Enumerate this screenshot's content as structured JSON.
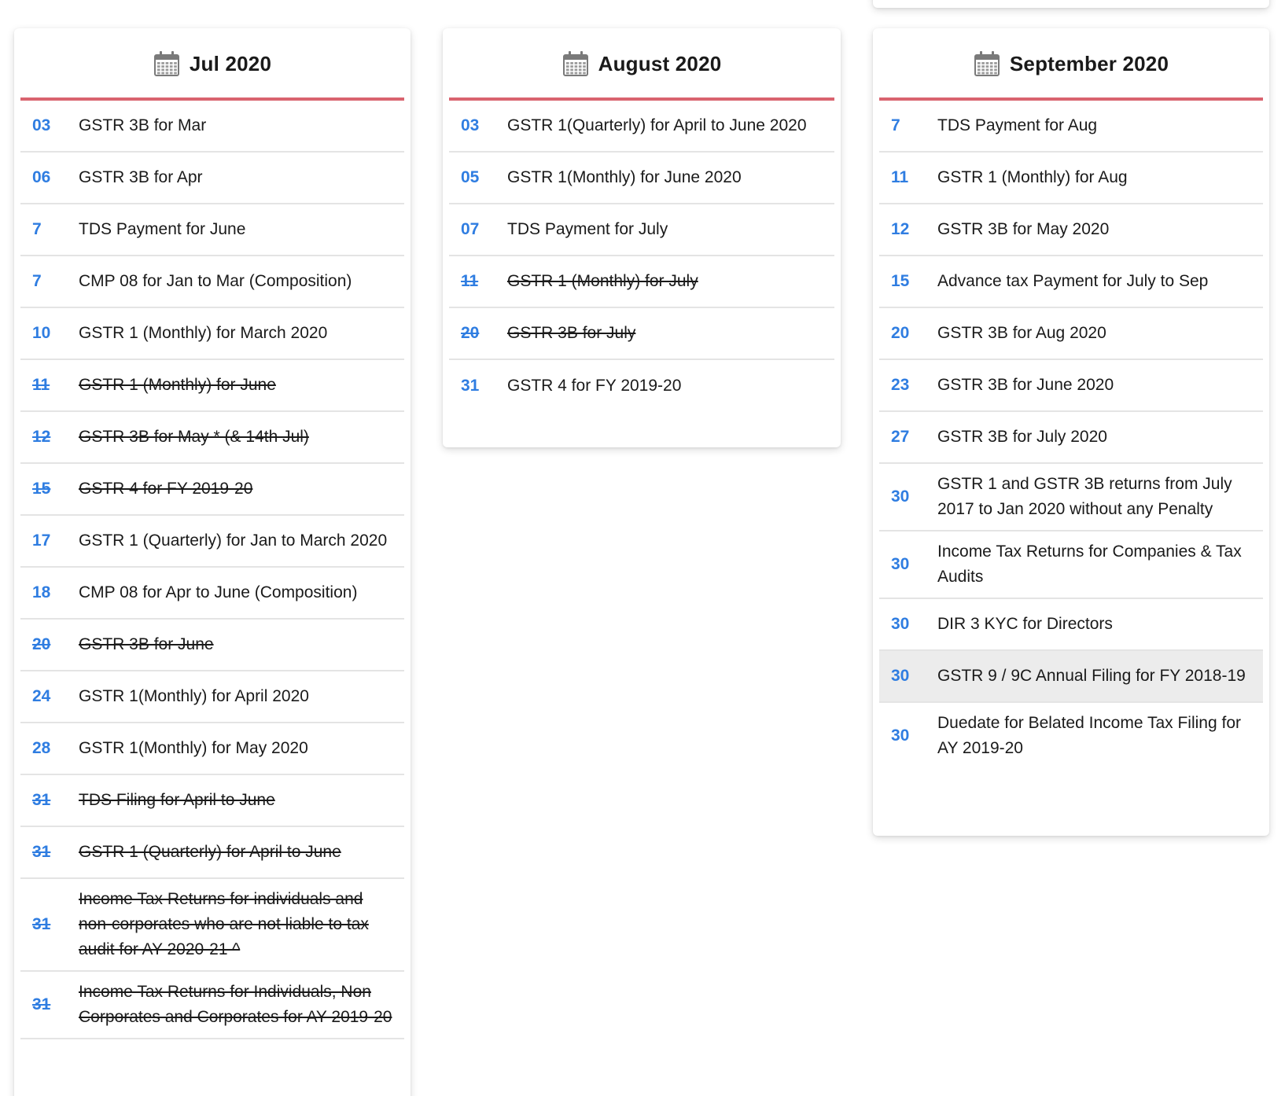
{
  "colors": {
    "accent_rule": "#d9636f",
    "date_blue": "#2f7de1",
    "highlight_row": "#ececec"
  },
  "icon": "calendar-icon",
  "columns": [
    {
      "title": "Jul 2020",
      "items": [
        {
          "day": "03",
          "text": "GSTR 3B for Mar",
          "done": false
        },
        {
          "day": "06",
          "text": "GSTR 3B for Apr",
          "done": false
        },
        {
          "day": "7",
          "text": "TDS Payment for June",
          "done": false
        },
        {
          "day": "7",
          "text": "CMP 08 for Jan to Mar (Composition)",
          "done": false
        },
        {
          "day": "10",
          "text": "GSTR 1 (Monthly) for March 2020",
          "done": false
        },
        {
          "day": "11",
          "text": "GSTR 1 (Monthly) for June",
          "done": true
        },
        {
          "day": "12",
          "text": "GSTR 3B for May * (& 14th Jul)",
          "done": true
        },
        {
          "day": "15",
          "text": "GSTR 4 for FY 2019-20",
          "done": true
        },
        {
          "day": "17",
          "text": "GSTR 1 (Quarterly) for Jan to March 2020",
          "done": false
        },
        {
          "day": "18",
          "text": "CMP 08 for Apr to June (Composition)",
          "done": false
        },
        {
          "day": "20",
          "text": "GSTR 3B for June",
          "done": true
        },
        {
          "day": "24",
          "text": "GSTR 1(Monthly) for April 2020",
          "done": false
        },
        {
          "day": "28",
          "text": "GSTR 1(Monthly) for May 2020",
          "done": false
        },
        {
          "day": "31",
          "text": "TDS Filing for April to June",
          "done": true
        },
        {
          "day": "31",
          "text": "GSTR 1 (Quarterly) for April to June",
          "done": true
        },
        {
          "day": "31",
          "text": "Income Tax Returns for individuals and non-corporates who are not liable to tax audit for AY 2020-21 ^",
          "done": true
        },
        {
          "day": "31",
          "text": "Income Tax Returns for Individuals, Non Corporates and Corporates for AY 2019-20",
          "done": true
        }
      ]
    },
    {
      "title": "August 2020",
      "items": [
        {
          "day": "03",
          "text": "GSTR 1(Quarterly) for April to June 2020",
          "done": false
        },
        {
          "day": "05",
          "text": "GSTR 1(Monthly) for June 2020",
          "done": false
        },
        {
          "day": "07",
          "text": "TDS Payment for July",
          "done": false
        },
        {
          "day": "11",
          "text": "GSTR 1 (Monthly) for July",
          "done": true
        },
        {
          "day": "20",
          "text": "GSTR 3B for July",
          "done": true
        },
        {
          "day": "31",
          "text": "GSTR 4 for FY 2019-20",
          "done": false
        }
      ]
    },
    {
      "title": "September 2020",
      "items": [
        {
          "day": "7",
          "text": "TDS Payment for Aug",
          "done": false
        },
        {
          "day": "11",
          "text": "GSTR 1 (Monthly) for Aug",
          "done": false
        },
        {
          "day": "12",
          "text": "GSTR 3B for May 2020",
          "done": false
        },
        {
          "day": "15",
          "text": "Advance tax Payment for July to Sep",
          "done": false
        },
        {
          "day": "20",
          "text": "GSTR 3B for Aug 2020",
          "done": false
        },
        {
          "day": "23",
          "text": "GSTR 3B for June 2020",
          "done": false
        },
        {
          "day": "27",
          "text": "GSTR 3B for July 2020",
          "done": false
        },
        {
          "day": "30",
          "text": "GSTR 1 and GSTR 3B returns from July 2017 to Jan 2020 without any Penalty",
          "done": false
        },
        {
          "day": "30",
          "text": "Income Tax Returns for Companies & Tax Audits",
          "done": false
        },
        {
          "day": "30",
          "text": "DIR 3 KYC for Directors",
          "done": false
        },
        {
          "day": "30",
          "text": "GSTR 9 / 9C Annual Filing for FY 2018-19",
          "done": false,
          "highlighted": true
        },
        {
          "day": "30",
          "text": "Duedate for Belated Income Tax Filing for AY 2019-20",
          "done": false
        }
      ]
    }
  ]
}
